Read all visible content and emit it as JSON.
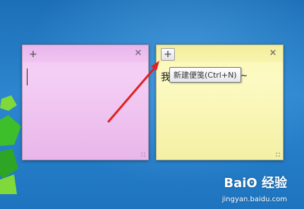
{
  "colors": {
    "desktop": "#2c86cf",
    "pink_note": "#f1c8f3",
    "yellow_note": "#fbf7b6",
    "annotation_arrow": "#e02020"
  },
  "notes": [
    {
      "id": "pink",
      "add_icon": "+",
      "close_icon": "✕",
      "text": ""
    },
    {
      "id": "yellow",
      "add_icon": "+",
      "close_icon": "✕",
      "text": "我"
    }
  ],
  "tooltip": {
    "text": "新建便笺(Ctrl+N)",
    "tail_text": "~"
  },
  "watermark": {
    "brand": "Baiʘ 经验",
    "url": "jingyan.baidu.com"
  }
}
